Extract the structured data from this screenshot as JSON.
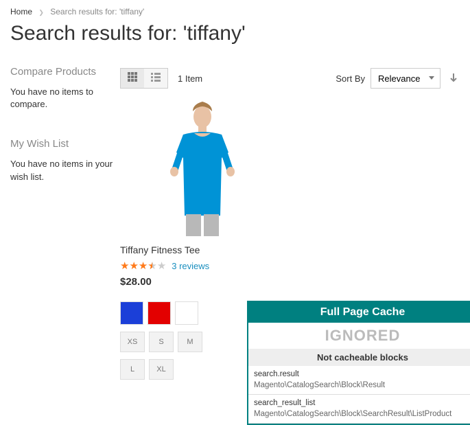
{
  "breadcrumbs": {
    "home": "Home",
    "current": "Search results for: 'tiffany'"
  },
  "title": "Search results for: 'tiffany'",
  "sidebar": {
    "compare_head": "Compare Products",
    "compare_empty": "You have no items to compare.",
    "wishlist_head": "My Wish List",
    "wishlist_empty": "You have no items in your wish list."
  },
  "toolbar": {
    "count": "1 Item",
    "sort_label": "Sort By",
    "sort_value": "Relevance"
  },
  "product": {
    "name": "Tiffany Fitness Tee",
    "reviews_link": "3 reviews",
    "price": "$28.00",
    "swatches": [
      {
        "name": "blue",
        "hex": "#1b3fd8"
      },
      {
        "name": "red",
        "hex": "#e30000"
      },
      {
        "name": "white",
        "hex": "#ffffff"
      }
    ],
    "sizes": [
      "XS",
      "S",
      "M",
      "L",
      "XL"
    ]
  },
  "cache": {
    "title": "Full Page Cache",
    "status": "IGNORED",
    "subhead": "Not cacheable blocks",
    "blocks": [
      {
        "name": "search.result",
        "class": "Magento\\CatalogSearch\\Block\\Result"
      },
      {
        "name": "search_result_list",
        "class": "Magento\\CatalogSearch\\Block\\SearchResult\\ListProduct"
      }
    ]
  }
}
